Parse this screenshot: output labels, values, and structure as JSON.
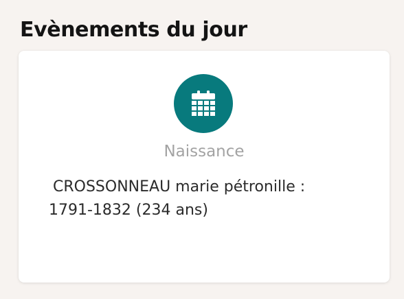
{
  "section": {
    "title": "Evènements du jour"
  },
  "event": {
    "icon": "calendar-icon",
    "icon_bg_color": "#087a7d",
    "type": "Naissance",
    "name_line": "CROSSONNEAU marie pétronille :",
    "dates_line": "1791-1832 (234 ans)"
  }
}
